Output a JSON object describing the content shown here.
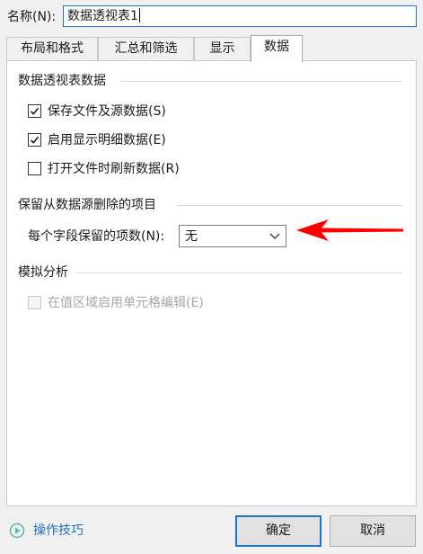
{
  "name_field": {
    "label": "名称(N):",
    "value": "数据透视表1"
  },
  "tabs": [
    {
      "label": "布局和格式",
      "active": false
    },
    {
      "label": "汇总和筛选",
      "active": false
    },
    {
      "label": "显示",
      "active": false
    },
    {
      "label": "数据",
      "active": true
    }
  ],
  "pivot_data": {
    "title": "数据透视表数据",
    "checkboxes": [
      {
        "label": "保存文件及源数据(S)",
        "checked": true
      },
      {
        "label": "启用显示明细数据(E)",
        "checked": true
      },
      {
        "label": "打开文件时刷新数据(R)",
        "checked": false
      }
    ]
  },
  "retain_items": {
    "title": "保留从数据源删除的项目",
    "field_label": "每个字段保留的项数(N):",
    "selected_value": "无"
  },
  "what_if": {
    "title": "模拟分析",
    "checkbox": {
      "label": "在值区域启用单元格编辑(E)",
      "checked": false,
      "disabled": true
    }
  },
  "footer": {
    "help_label": "操作技巧",
    "ok_label": "确定",
    "cancel_label": "取消"
  },
  "colors": {
    "accent": "#1f74c4",
    "arrow": "#ff0000",
    "link": "#1f6fc0"
  }
}
